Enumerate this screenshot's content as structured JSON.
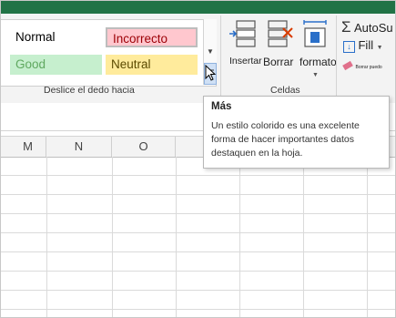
{
  "ribbon": {
    "cell_styles": [
      {
        "label": "Normal",
        "bg": "#ffffff",
        "color": "#000000"
      },
      {
        "label": "Incorrecto",
        "bg": "#ffc7ce",
        "color": "#9c0006"
      },
      {
        "label": "Good",
        "bg": "#c6efce",
        "color": "#5fa85f"
      },
      {
        "label": "Neutral",
        "bg": "#ffeb9c",
        "color": "#5a4a00"
      }
    ],
    "styles_group_label": "Deslice el dedo hacia",
    "cells_group_label": "Celdas",
    "insert_label": "Insertar",
    "delete_label": "Borrar",
    "format_label": "formato",
    "autosum_label": "AutoSu",
    "fill_label": "Fill",
    "clear_label": "Borrar puedo",
    "edge_letters": "s"
  },
  "sheet": {
    "column_headers": [
      "M",
      "N",
      "O",
      "",
      "",
      ""
    ]
  },
  "tooltip": {
    "title": "Más",
    "body": "Un estilo colorido es una excelente forma de hacer importantes datos destaquen en la hoja."
  },
  "colors": {
    "excel_green": "#217346",
    "ribbon_bg": "#f3f3f3"
  },
  "icons": [
    "scroll-down-icon",
    "more-styles-icon",
    "insert-cells-icon",
    "delete-cells-icon",
    "format-cells-icon",
    "autosum-icon",
    "fill-icon",
    "eraser-icon",
    "mouse-cursor-icon"
  ]
}
